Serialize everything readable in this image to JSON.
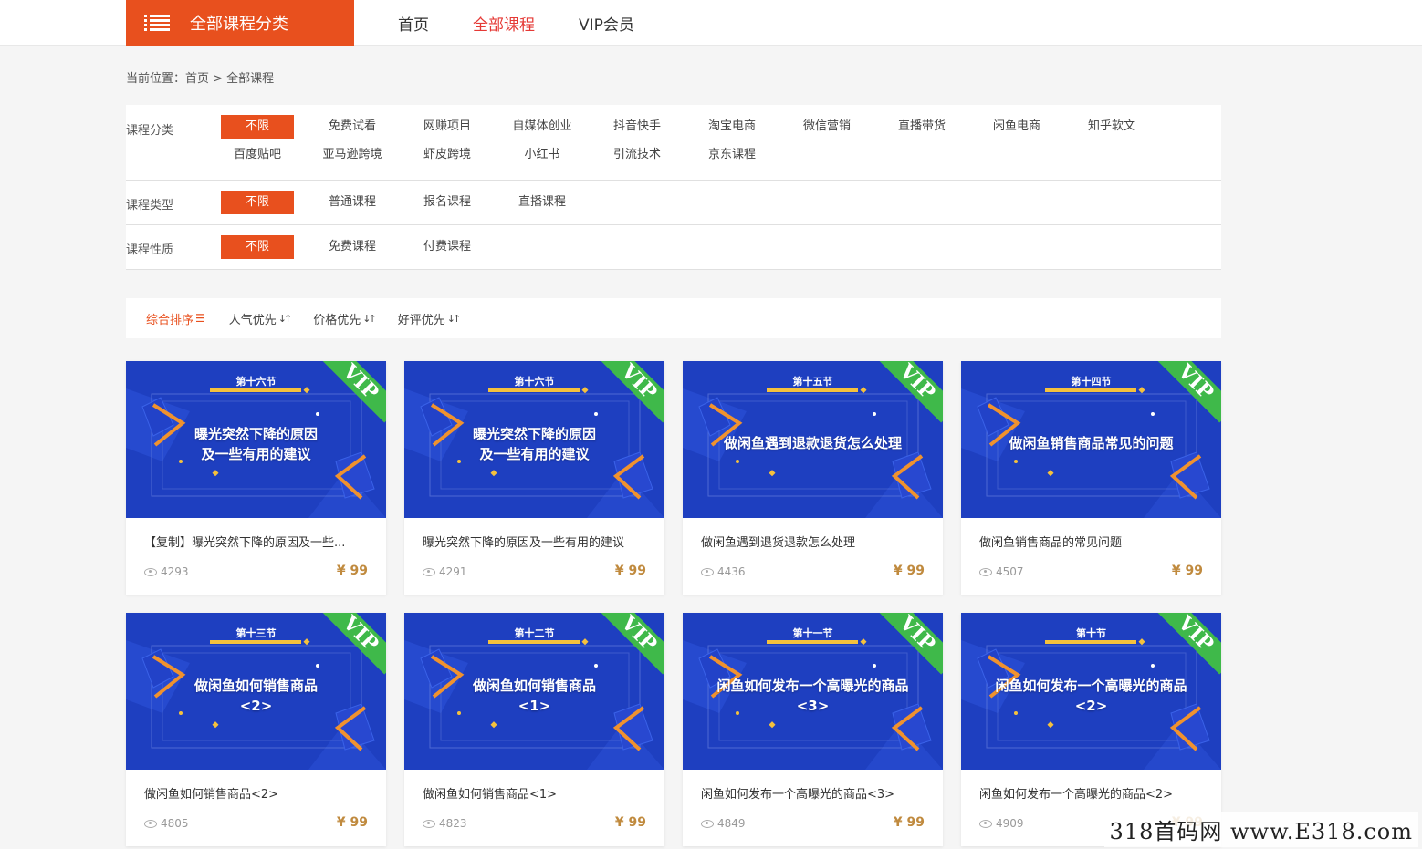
{
  "header": {
    "category_label": "全部课程分类",
    "nav": [
      {
        "label": "首页",
        "active": false
      },
      {
        "label": "全部课程",
        "active": true
      },
      {
        "label": "VIP会员",
        "active": false
      }
    ]
  },
  "breadcrumb": "当前位置：首页 > 全部课程",
  "filters": [
    {
      "label": "课程分类",
      "options": [
        "不限",
        "免费试看",
        "网赚项目",
        "自媒体创业",
        "抖音快手",
        "淘宝电商",
        "微信营销",
        "直播带货",
        "闲鱼电商",
        "知乎软文",
        "百度贴吧",
        "亚马逊跨境",
        "虾皮跨境",
        "小红书",
        "引流技术",
        "京东课程"
      ],
      "selected": "不限"
    },
    {
      "label": "课程类型",
      "options": [
        "不限",
        "普通课程",
        "报名课程",
        "直播课程"
      ],
      "selected": "不限"
    },
    {
      "label": "课程性质",
      "options": [
        "不限",
        "免费课程",
        "付费课程"
      ],
      "selected": "不限"
    }
  ],
  "sort": [
    {
      "label": "综合排序",
      "icon": "list-icon",
      "active": true
    },
    {
      "label": "人气优先",
      "icon": "sort-arrows-icon",
      "active": false
    },
    {
      "label": "价格优先",
      "icon": "sort-arrows-icon",
      "active": false
    },
    {
      "label": "好评优先",
      "icon": "sort-arrows-icon",
      "active": false
    }
  ],
  "courses": [
    {
      "section": "第十六节",
      "thumb_title": "曝光突然下降的原因\n及一些有用的建议",
      "title": "【复制】曝光突然下降的原因及一些...",
      "views": "4293",
      "price": "¥ 99",
      "badge": "VIP"
    },
    {
      "section": "第十六节",
      "thumb_title": "曝光突然下降的原因\n及一些有用的建议",
      "title": "曝光突然下降的原因及一些有用的建议",
      "views": "4291",
      "price": "¥ 99",
      "badge": "VIP"
    },
    {
      "section": "第十五节",
      "thumb_title": "做闲鱼遇到退款退货怎么处理",
      "title": "做闲鱼遇到退货退款怎么处理",
      "views": "4436",
      "price": "¥ 99",
      "badge": "VIP"
    },
    {
      "section": "第十四节",
      "thumb_title": "做闲鱼销售商品常见的问题",
      "title": "做闲鱼销售商品的常见问题",
      "views": "4507",
      "price": "¥ 99",
      "badge": "VIP"
    },
    {
      "section": "第十三节",
      "thumb_title": "做闲鱼如何销售商品\n<2>",
      "title": "做闲鱼如何销售商品<2>",
      "views": "4805",
      "price": "¥ 99",
      "badge": "VIP"
    },
    {
      "section": "第十二节",
      "thumb_title": "做闲鱼如何销售商品\n<1>",
      "title": "做闲鱼如何销售商品<1>",
      "views": "4823",
      "price": "¥ 99",
      "badge": "VIP"
    },
    {
      "section": "第十一节",
      "thumb_title": "闲鱼如何发布一个高曝光的商品\n<3>",
      "title": "闲鱼如何发布一个高曝光的商品<3>",
      "views": "4849",
      "price": "¥ 99",
      "badge": "VIP"
    },
    {
      "section": "第十节",
      "thumb_title": "闲鱼如何发布一个高曝光的商品\n<2>",
      "title": "闲鱼如何发布一个高曝光的商品<2>",
      "views": "4909",
      "price": "¥ 99",
      "badge": "VIP"
    }
  ],
  "watermark": "318首码网 www.E318.com",
  "colors": {
    "accent": "#e8501e",
    "nav_active": "#e53935",
    "thumb_bg": "#1e3fc0",
    "vip_green": "#3fb94a",
    "price": "#c08a3e"
  }
}
